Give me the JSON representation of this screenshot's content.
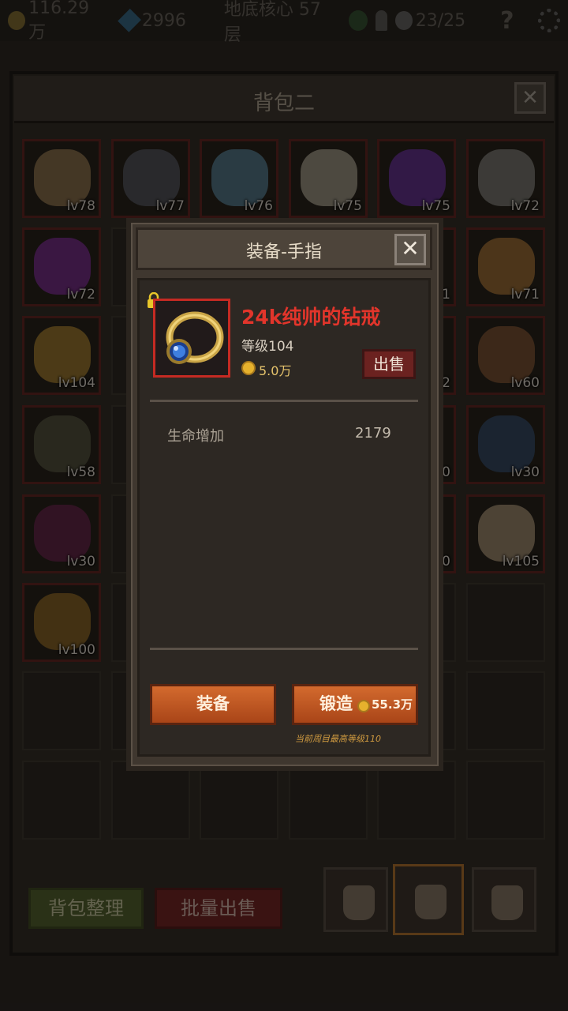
{
  "topbar": {
    "gold": "116.29万",
    "gems": "2996",
    "stage": "地底核心 57层",
    "skulls": "23/25",
    "help": "?"
  },
  "bag": {
    "title": "背包二",
    "close": "✕",
    "sort_button": "背包整理",
    "bulk_sell_button": "批量出售",
    "slots": [
      {
        "level": "lv78",
        "color": "#7c6444"
      },
      {
        "level": "lv77",
        "color": "#4b4b50"
      },
      {
        "level": "lv76",
        "color": "#4d6c7a"
      },
      {
        "level": "lv75",
        "color": "#8d8676"
      },
      {
        "level": "lv75",
        "color": "#5b2f80"
      },
      {
        "level": "lv72",
        "color": "#6d6b64"
      },
      {
        "level": "lv72",
        "color": "#6a2a78"
      },
      {
        "level": "",
        "color": ""
      },
      {
        "level": "",
        "color": ""
      },
      {
        "level": "",
        "color": ""
      },
      {
        "level": "1",
        "color": ""
      },
      {
        "level": "lv71",
        "color": "#8a6230"
      },
      {
        "level": "lv104",
        "color": "#8a6a2a"
      },
      {
        "level": "",
        "color": ""
      },
      {
        "level": "",
        "color": ""
      },
      {
        "level": "",
        "color": ""
      },
      {
        "level": "2",
        "color": ""
      },
      {
        "level": "lv60",
        "color": "#6e4a2e"
      },
      {
        "level": "lv58",
        "color": "#4c4a38"
      },
      {
        "level": "",
        "color": ""
      },
      {
        "level": "",
        "color": ""
      },
      {
        "level": "",
        "color": ""
      },
      {
        "level": "0",
        "color": ""
      },
      {
        "level": "lv30",
        "color": "#324258"
      },
      {
        "level": "lv30",
        "color": "#5a2440"
      },
      {
        "level": "",
        "color": ""
      },
      {
        "level": "",
        "color": ""
      },
      {
        "level": "",
        "color": ""
      },
      {
        "level": "0",
        "color": ""
      },
      {
        "level": "lv105",
        "color": "#8c7a62"
      },
      {
        "level": "lv100",
        "color": "#7a5a24"
      }
    ]
  },
  "modal": {
    "title": "装备-手指",
    "close": "✕",
    "item_name": "24k纯帅的钻戒",
    "item_level": "等级104",
    "item_price": "5.0万",
    "sell_button": "出售",
    "stats": [
      {
        "label": "生命增加",
        "value": "2179"
      }
    ],
    "equip_button": "装备",
    "forge_button": "锻造",
    "forge_cost": "55.3万",
    "max_level_note": "当前周目最高等级110"
  }
}
